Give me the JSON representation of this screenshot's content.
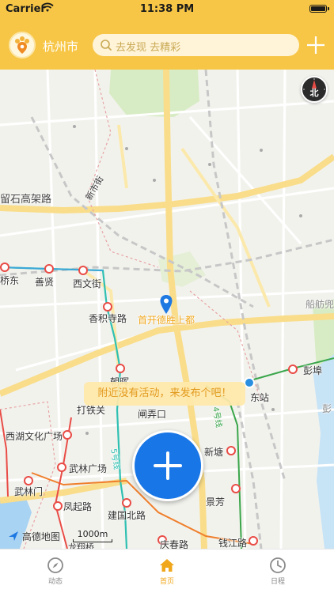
{
  "status_bar": {
    "carrier": "Carrier",
    "time": "11:38 PM"
  },
  "nav": {
    "city": "杭州市",
    "search_placeholder": "去发现 去精彩",
    "accent": "#f7c646"
  },
  "map": {
    "compass_label": "北",
    "labels": {
      "liushi": "留石高架路",
      "xinshi": "新市街",
      "chuanhang": "船舫兜",
      "shanxian": "善贤",
      "xiwen": "西文街",
      "qiaodong": "桥东",
      "xiangji": "香积寺路",
      "dong": "东站",
      "pengbu": "彭埠",
      "peng": "彭",
      "dalie": "打铁关",
      "xihu": "西湖文化广场",
      "xintang": "新塘",
      "wulin": "武林广场",
      "wulinmen": "武林门",
      "jingfang": "景芳",
      "fengqi": "凤起路",
      "jianguo": "建国北路",
      "qingchun": "庆春路",
      "qianjiang": "钱江路",
      "longxiang": "龙翔桥",
      "chaowang": "朝晖",
      "yan": "闸弄口",
      "line4": "4号线",
      "line5": "5号线"
    },
    "pin_label": "首开德胜上都",
    "toast": "附近没有活动，来发布个吧！",
    "logo_text": "高德地图",
    "scale_text": "1000m"
  },
  "tabbar": {
    "items": [
      {
        "label": "动态",
        "icon": "compass-icon"
      },
      {
        "label": "首页",
        "icon": "home-icon"
      },
      {
        "label": "日程",
        "icon": "clock-icon"
      }
    ],
    "active": "首页",
    "active_color": "#f0a71b"
  }
}
